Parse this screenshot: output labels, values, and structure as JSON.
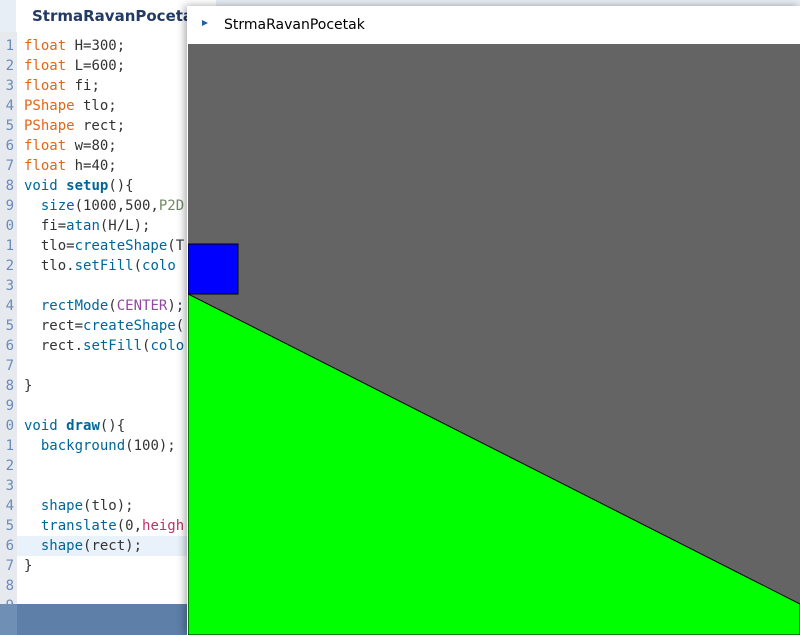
{
  "editor": {
    "tab_title": "StrmaRavanPocetak",
    "lines": [
      {
        "num": "1",
        "segments": [
          {
            "t": "float",
            "c": "kw-type"
          },
          {
            "t": " H=300;",
            "c": ""
          }
        ]
      },
      {
        "num": "2",
        "segments": [
          {
            "t": "float",
            "c": "kw-type"
          },
          {
            "t": " L=600;",
            "c": ""
          }
        ]
      },
      {
        "num": "3",
        "segments": [
          {
            "t": "float",
            "c": "kw-type"
          },
          {
            "t": " fi;",
            "c": ""
          }
        ]
      },
      {
        "num": "4",
        "segments": [
          {
            "t": "PShape",
            "c": "kw-type"
          },
          {
            "t": " tlo;",
            "c": ""
          }
        ]
      },
      {
        "num": "5",
        "segments": [
          {
            "t": "PShape",
            "c": "kw-type"
          },
          {
            "t": " rect;",
            "c": ""
          }
        ]
      },
      {
        "num": "6",
        "segments": [
          {
            "t": "float",
            "c": "kw-type"
          },
          {
            "t": " w=80;",
            "c": ""
          }
        ]
      },
      {
        "num": "7",
        "segments": [
          {
            "t": "float",
            "c": "kw-type"
          },
          {
            "t": " h=40;",
            "c": ""
          }
        ]
      },
      {
        "num": "8",
        "segments": [
          {
            "t": "void",
            "c": "kw-call"
          },
          {
            "t": " ",
            "c": ""
          },
          {
            "t": "setup",
            "c": "kw-fn"
          },
          {
            "t": "(){",
            "c": ""
          }
        ]
      },
      {
        "num": "9",
        "segments": [
          {
            "t": "  ",
            "c": ""
          },
          {
            "t": "size",
            "c": "kw-call"
          },
          {
            "t": "(1000,500,",
            "c": ""
          },
          {
            "t": "P2D",
            "c": "kw-const"
          }
        ]
      },
      {
        "num": "0",
        "segments": [
          {
            "t": "  fi=",
            "c": ""
          },
          {
            "t": "atan",
            "c": "kw-call"
          },
          {
            "t": "(H/L);",
            "c": ""
          }
        ]
      },
      {
        "num": "1",
        "segments": [
          {
            "t": "  tlo=",
            "c": ""
          },
          {
            "t": "createShape",
            "c": "kw-call"
          },
          {
            "t": "(T",
            "c": ""
          }
        ]
      },
      {
        "num": "2",
        "segments": [
          {
            "t": "  tlo.",
            "c": ""
          },
          {
            "t": "setFill",
            "c": "kw-call"
          },
          {
            "t": "(",
            "c": ""
          },
          {
            "t": "colo",
            "c": "kw-call"
          }
        ]
      },
      {
        "num": "3",
        "segments": []
      },
      {
        "num": "4",
        "segments": [
          {
            "t": "  ",
            "c": ""
          },
          {
            "t": "rectMode",
            "c": "kw-call"
          },
          {
            "t": "(",
            "c": ""
          },
          {
            "t": "CENTER",
            "c": "kw-purple"
          },
          {
            "t": ");",
            "c": ""
          }
        ]
      },
      {
        "num": "5",
        "segments": [
          {
            "t": "  rect=",
            "c": ""
          },
          {
            "t": "createShape",
            "c": "kw-call"
          },
          {
            "t": "(",
            "c": ""
          }
        ]
      },
      {
        "num": "6",
        "segments": [
          {
            "t": "  rect.",
            "c": ""
          },
          {
            "t": "setFill",
            "c": "kw-call"
          },
          {
            "t": "(",
            "c": ""
          },
          {
            "t": "colo",
            "c": "kw-call"
          }
        ]
      },
      {
        "num": "7",
        "segments": []
      },
      {
        "num": "8",
        "segments": [
          {
            "t": "}",
            "c": ""
          }
        ]
      },
      {
        "num": "9",
        "segments": []
      },
      {
        "num": "0",
        "segments": [
          {
            "t": "void",
            "c": "kw-call"
          },
          {
            "t": " ",
            "c": ""
          },
          {
            "t": "draw",
            "c": "kw-fn"
          },
          {
            "t": "(){",
            "c": ""
          }
        ]
      },
      {
        "num": "1",
        "segments": [
          {
            "t": "  ",
            "c": ""
          },
          {
            "t": "background",
            "c": "kw-call"
          },
          {
            "t": "(100);",
            "c": ""
          }
        ]
      },
      {
        "num": "2",
        "segments": []
      },
      {
        "num": "3",
        "segments": []
      },
      {
        "num": "4",
        "segments": [
          {
            "t": "  ",
            "c": ""
          },
          {
            "t": "shape",
            "c": "kw-call"
          },
          {
            "t": "(tlo);",
            "c": ""
          }
        ]
      },
      {
        "num": "5",
        "segments": [
          {
            "t": "  ",
            "c": ""
          },
          {
            "t": "translate",
            "c": "kw-call"
          },
          {
            "t": "(0,",
            "c": ""
          },
          {
            "t": "heigh",
            "c": "kw-pink"
          }
        ]
      },
      {
        "num": "6",
        "segments": [
          {
            "t": "  ",
            "c": ""
          },
          {
            "t": "shape",
            "c": "kw-call"
          },
          {
            "t": "(rect);",
            "c": ""
          }
        ],
        "current": true
      },
      {
        "num": "7",
        "segments": [
          {
            "t": "}",
            "c": ""
          }
        ]
      },
      {
        "num": "8",
        "segments": []
      },
      {
        "num": "9",
        "segments": []
      }
    ]
  },
  "sketch": {
    "window_title": "StrmaRavanPocetak",
    "background_color": "#646464",
    "incline_color": "#00ff00",
    "box_color": "#0000ff"
  }
}
